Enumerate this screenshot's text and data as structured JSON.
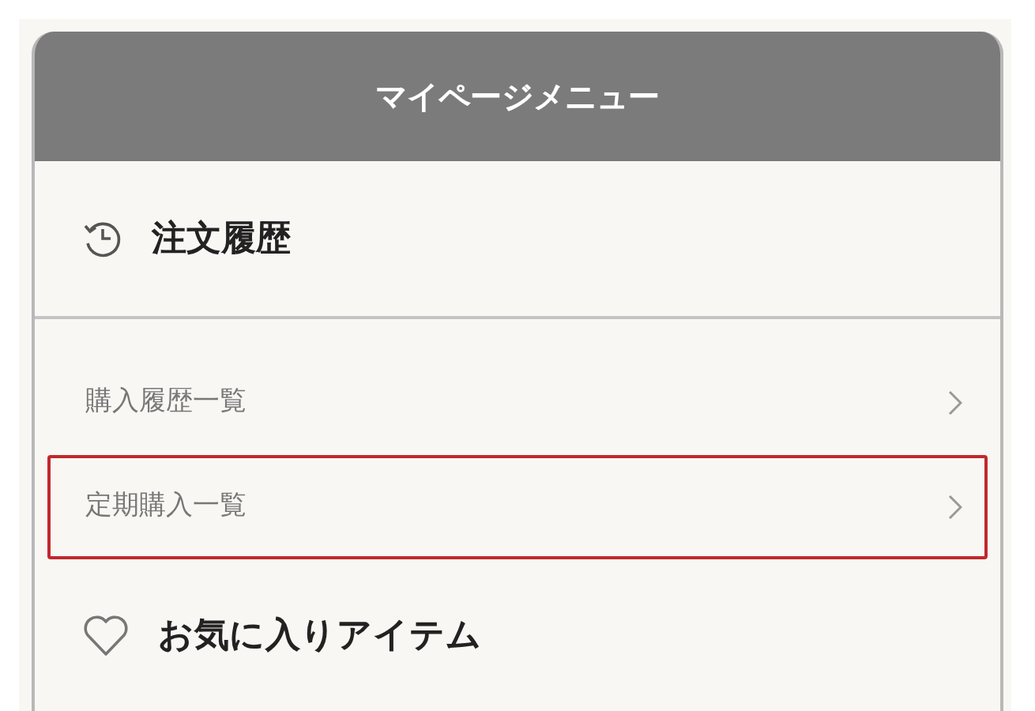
{
  "header": {
    "title": "マイページメニュー"
  },
  "sections": [
    {
      "title": "注文履歴",
      "kind": "history",
      "items": [
        {
          "label": "購入履歴一覧",
          "highlighted": false
        },
        {
          "label": "定期購入一覧",
          "highlighted": true
        }
      ]
    },
    {
      "title": "お気に入りアイテム",
      "kind": "favorite"
    }
  ]
}
